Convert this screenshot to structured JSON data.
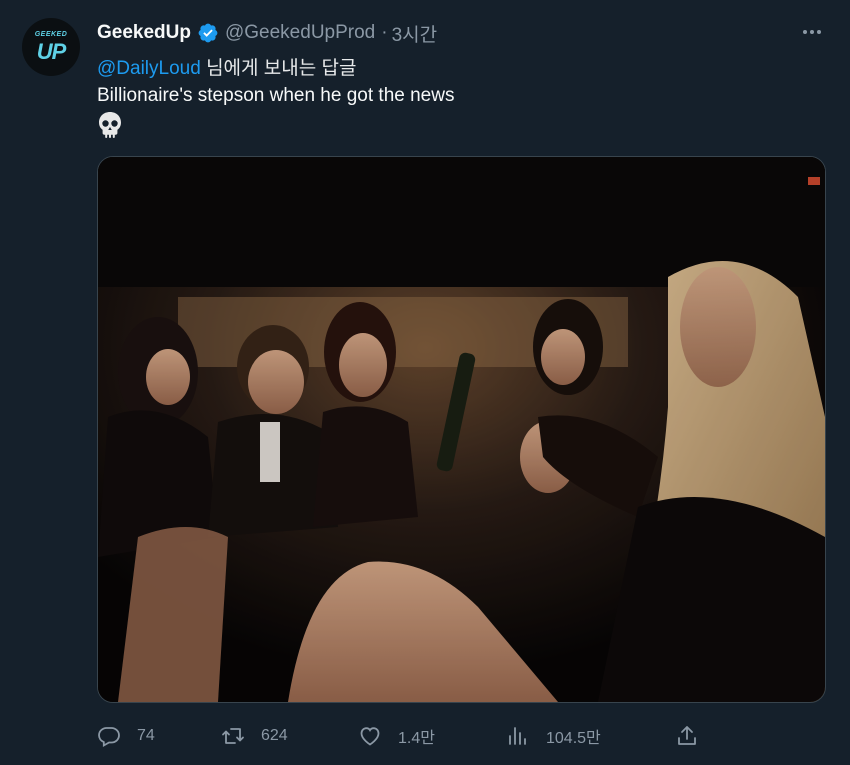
{
  "tweet": {
    "display_name": "GeekedUp",
    "handle": "@GeekedUpProd",
    "separator": "·",
    "time": "3시간",
    "avatar": {
      "logo_top": "GEEKED",
      "logo_main": "UP"
    },
    "reply_mention": "@DailyLoud",
    "reply_suffix": "님에게 보내는 답글",
    "text": "Billionaire's stepson when he got the news",
    "emoji": "skull",
    "accent_color": "#1d9bf0",
    "verified_color": "#1d9bf0",
    "icons": {
      "more": "more-horizontal-icon",
      "verified": "verified-badge-icon"
    }
  },
  "media": {
    "description_icon": "photo"
  },
  "actions": {
    "reply": {
      "icon": "reply-icon",
      "count": "74"
    },
    "retweet": {
      "icon": "retweet-icon",
      "count": "624"
    },
    "like": {
      "icon": "heart-icon",
      "count": "1.4만"
    },
    "views": {
      "icon": "views-icon",
      "count": "104.5만"
    },
    "share": {
      "icon": "share-icon"
    }
  }
}
